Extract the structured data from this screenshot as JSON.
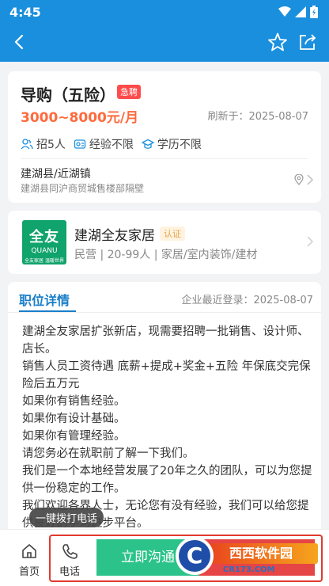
{
  "status_bar": {
    "time": "4:45"
  },
  "job": {
    "title": "导购（五险）",
    "urgent_badge": "急聘",
    "salary": "3000~8000元/月",
    "refresh": "刷新于：2025-08-07",
    "requirements": [
      "招5人",
      "经验不限",
      "学历不限"
    ],
    "location_main": "建湖县/近湖镇",
    "location_detail": "建湖县同沪商贸城售楼部隔壁"
  },
  "company": {
    "logo_main": "全友",
    "logo_sub": "QUANU",
    "logo_tag": "全友家居  温暖世界",
    "name": "建湖全友家居",
    "cert_badge": "认证",
    "meta": "民营 | 20-99人 | 家居/室内装饰/建材"
  },
  "detail": {
    "tab": "职位详情",
    "last_login": "企业最近登录：2025-08-07",
    "lines": [
      "建湖全友家居扩张新店，现需要招聘一批销售、设计师、店长。",
      "销售人员工资待遇 底薪+提成+奖金+五险 年保底交完保险后五万元",
      "如果你有销售经验。",
      "如果你有设计基础。",
      "如果你有管理经验。",
      "请您务必在就职前了解一下我们。",
      "我们是一个本地经营发展了20年之久的团队，可以为您提供一份稳定的工作。",
      "我们欢迎各界人士，无论您有没有经验，我们可以给您提供良好的学习进步平台。"
    ]
  },
  "tooltip": "一键拨打电话",
  "bottom_bar": {
    "home": "首页",
    "phone": "电话",
    "chat": "立即沟通"
  },
  "watermark": {
    "brand": "西西软件园",
    "url": "CR173.COM",
    "letter": "C"
  },
  "colors": {
    "primary": "#1a8fdd",
    "salary": "#ff6a3d",
    "chat": "#2cc38a",
    "apply": "#e64545",
    "highlight_border": "#e03a2e"
  }
}
